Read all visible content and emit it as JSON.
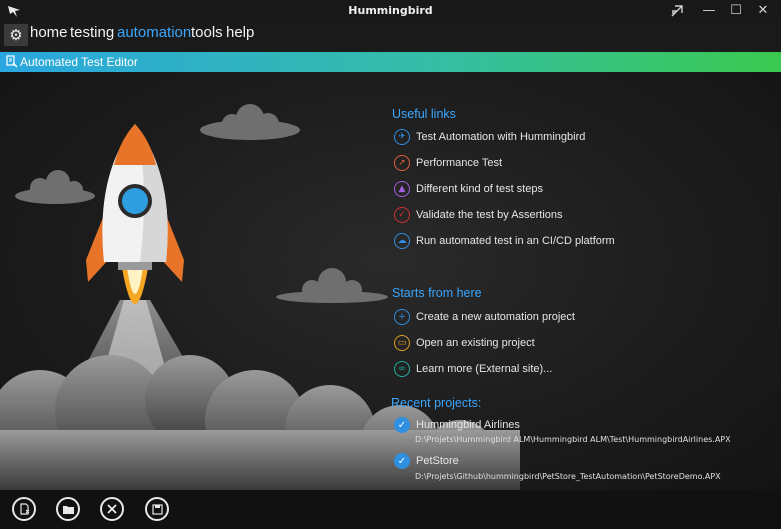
{
  "window": {
    "title": "Hummingbird",
    "controls": {
      "minimize": "—",
      "maximize": "☐",
      "close": "✕"
    }
  },
  "menu": {
    "settings_icon": "gear-icon",
    "items": [
      {
        "label": "home",
        "active": false
      },
      {
        "label": "testing",
        "active": false
      },
      {
        "label": "automation",
        "active": true
      },
      {
        "label": "tools",
        "active": false
      },
      {
        "label": "help",
        "active": false
      }
    ]
  },
  "header": {
    "title": "Automated Test Editor"
  },
  "useful_links": {
    "title": "Useful links",
    "items": [
      {
        "label": "Test Automation with Hummingbird",
        "icon": "bird-icon",
        "color": "#2f8fe0"
      },
      {
        "label": "Performance Test",
        "icon": "rocket-icon",
        "color": "#e0603a"
      },
      {
        "label": "Different kind of test steps",
        "icon": "flask-icon",
        "color": "#a060e0"
      },
      {
        "label": "Validate the test by Assertions",
        "icon": "check-icon",
        "color": "#d03030"
      },
      {
        "label": "Run automated test in an CI/CD platform",
        "icon": "cloud-icon",
        "color": "#2f8fe0"
      }
    ]
  },
  "starts": {
    "title": "Starts from here",
    "items": [
      {
        "label": "Create a new automation project",
        "icon": "new-file-icon",
        "color": "#2f8fe0"
      },
      {
        "label": "Open an existing project",
        "icon": "folder-icon",
        "color": "#e0a020"
      },
      {
        "label": "Learn more (External site)...",
        "icon": "link-icon",
        "color": "#20b0a0"
      }
    ]
  },
  "recent": {
    "title": "Recent projects:",
    "items": [
      {
        "name": "Hummingbird Airlines",
        "path": "D:\\Projets\\Hummingbird ALM\\Hummingbird ALM\\Test\\HummingbirdAirlines.APX"
      },
      {
        "name": "PetStore",
        "path": "D:\\Projets\\Github\\hummingbird\\PetStore_TestAutomation\\PetStoreDemo.APX"
      }
    ]
  },
  "toolbar": {
    "buttons": [
      "new-project-icon",
      "open-folder-icon",
      "close-icon",
      "save-icon"
    ]
  },
  "colors": {
    "accent": "#3aa6ff",
    "band_start": "#2aa7e0",
    "band_end": "#3ac94f"
  }
}
